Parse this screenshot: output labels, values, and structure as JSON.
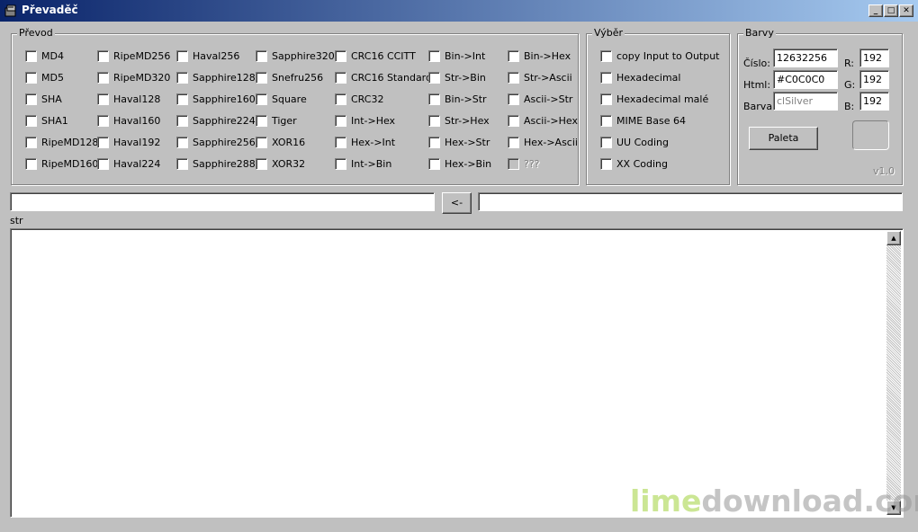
{
  "window": {
    "title": "Převaděč",
    "accent": "#0a246a",
    "face_color": "#c0c0c0",
    "buttons": {
      "minimize": "_",
      "maximize": "□",
      "close": "✕"
    }
  },
  "prevod": {
    "label": "Převod",
    "columns": [
      [
        "MD4",
        "MD5",
        "SHA",
        "SHA1",
        "RipeMD128",
        "RipeMD160"
      ],
      [
        "RipeMD256",
        "RipeMD320",
        "Haval128",
        "Haval160",
        "Haval192",
        "Haval224"
      ],
      [
        "Haval256",
        "Sapphire128",
        "Sapphire160",
        "Sapphire224",
        "Sapphire256",
        "Sapphire288"
      ],
      [
        "Sapphire320",
        "Snefru256",
        "Square",
        "Tiger",
        "XOR16",
        "XOR32"
      ],
      [
        "CRC16 CCITT",
        "CRC16 Standard",
        "CRC32",
        "Int->Hex",
        "Hex->Int",
        "Int->Bin"
      ],
      [
        "Bin->Int",
        "Str->Bin",
        "Bin->Str",
        "Str->Hex",
        "Hex->Str",
        "Hex->Bin"
      ],
      [
        "Bin->Hex",
        "Str->Ascii",
        "Ascii->Str",
        "Ascii->Hex",
        "Hex->Ascii",
        "???"
      ]
    ]
  },
  "vyber": {
    "label": "Výběr",
    "items": [
      "copy Input to Output",
      "Hexadecimal",
      "Hexadecimal malé",
      "MIME Base 64",
      "UU Coding",
      "XX Coding"
    ]
  },
  "barvy": {
    "label": "Barvy",
    "cislo_label": "Číslo:",
    "cislo_value": "12632256",
    "html_label": "Html:",
    "html_value": "#C0C0C0",
    "barva_label": "Barva:",
    "barva_value": "clSilver",
    "r_label": "R:",
    "r_value": "192",
    "g_label": "G:",
    "g_value": "192",
    "b_label": "B:",
    "b_value": "192",
    "paleta_button": "Paleta",
    "version": "v1.0",
    "swatch_color": "#c0c0c0"
  },
  "io": {
    "input_value": "",
    "arrow_button": "<-",
    "output_value": "",
    "mode_label": "str"
  },
  "scrollbar": {
    "up": "▲",
    "down": "▼"
  },
  "watermark": {
    "part1": "lime",
    "part2": "download.com"
  }
}
